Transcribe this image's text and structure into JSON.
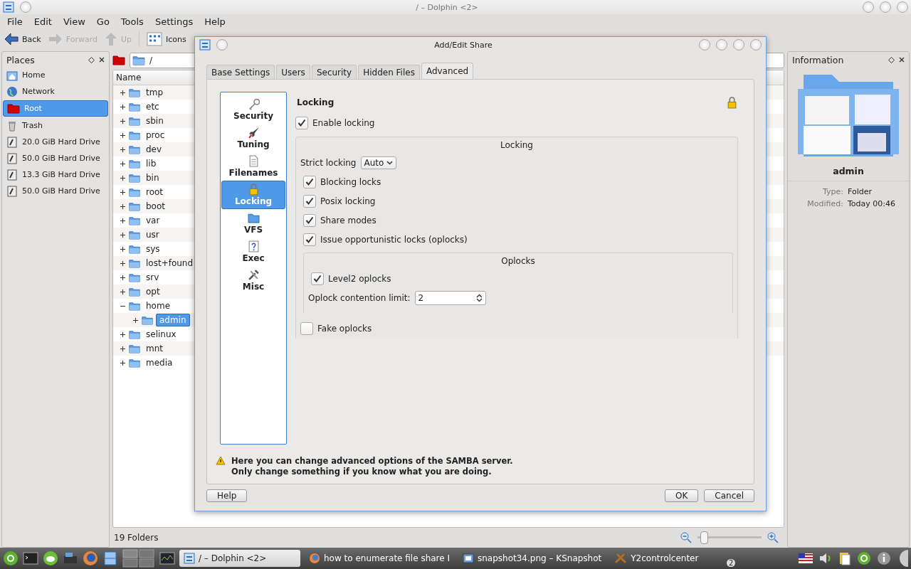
{
  "main_window": {
    "title": "/ – Dolphin <2>"
  },
  "menu": [
    "File",
    "Edit",
    "View",
    "Go",
    "Tools",
    "Settings",
    "Help"
  ],
  "toolbar": [
    {
      "label": "Back",
      "kind": "back",
      "disabled": false
    },
    {
      "label": "Forward",
      "kind": "forward",
      "disabled": true
    },
    {
      "label": "Up",
      "kind": "up",
      "disabled": true
    },
    {
      "label": "Icons",
      "kind": "view",
      "disabled": false
    }
  ],
  "places": {
    "title": "Places",
    "items": [
      {
        "label": "Home",
        "kind": "home",
        "selected": false
      },
      {
        "label": "Network",
        "kind": "network",
        "selected": false
      },
      {
        "label": "Root",
        "kind": "root",
        "selected": true
      },
      {
        "label": "Trash",
        "kind": "trash",
        "selected": false
      },
      {
        "label": "20.0 GiB Hard Drive",
        "kind": "drive",
        "selected": false
      },
      {
        "label": "50.0 GiB Hard Drive",
        "kind": "drive",
        "selected": false
      },
      {
        "label": "13.3 GiB Hard Drive",
        "kind": "drive",
        "selected": false
      },
      {
        "label": "50.0 GiB Hard Drive",
        "kind": "drive",
        "selected": false
      }
    ]
  },
  "location": "/",
  "files": {
    "column": "Name",
    "items": [
      {
        "name": "tmp",
        "expanded": false,
        "selected": false
      },
      {
        "name": "etc",
        "expanded": false,
        "selected": false
      },
      {
        "name": "sbin",
        "expanded": false,
        "selected": false
      },
      {
        "name": "proc",
        "expanded": false,
        "selected": false
      },
      {
        "name": "dev",
        "expanded": false,
        "selected": false
      },
      {
        "name": "lib",
        "expanded": false,
        "selected": false
      },
      {
        "name": "bin",
        "expanded": false,
        "selected": false
      },
      {
        "name": "root",
        "expanded": false,
        "selected": false
      },
      {
        "name": "boot",
        "expanded": false,
        "selected": false
      },
      {
        "name": "var",
        "expanded": false,
        "selected": false
      },
      {
        "name": "usr",
        "expanded": false,
        "selected": false
      },
      {
        "name": "sys",
        "expanded": false,
        "selected": false
      },
      {
        "name": "lost+found",
        "expanded": false,
        "selected": false
      },
      {
        "name": "srv",
        "expanded": false,
        "selected": false
      },
      {
        "name": "opt",
        "expanded": false,
        "selected": false
      },
      {
        "name": "home",
        "expanded": true,
        "selected": false,
        "children": [
          {
            "name": "admin",
            "expanded": false,
            "selected": true
          }
        ]
      },
      {
        "name": "selinux",
        "expanded": false,
        "selected": false
      },
      {
        "name": "mnt",
        "expanded": false,
        "selected": false
      },
      {
        "name": "media",
        "expanded": false,
        "selected": false
      }
    ]
  },
  "status": "19 Folders",
  "zoom_slider": {
    "level": 0.05
  },
  "information": {
    "title": "Information",
    "name": "admin",
    "fields": [
      {
        "label": "Type:",
        "value": "Folder"
      },
      {
        "label": "Modified:",
        "value": "Today 00:46"
      }
    ]
  },
  "dialog": {
    "title": "Add/Edit Share",
    "tabs": [
      {
        "label": "Base Settings",
        "selected": false
      },
      {
        "label": "Users",
        "selected": false
      },
      {
        "label": "Security",
        "selected": false
      },
      {
        "label": "Hidden Files",
        "selected": false
      },
      {
        "label": "Advanced",
        "selected": true
      }
    ],
    "sections": [
      {
        "label": "Security",
        "kind": "key",
        "selected": false
      },
      {
        "label": "Tuning",
        "kind": "rocket",
        "selected": false
      },
      {
        "label": "Filenames",
        "kind": "page",
        "selected": false
      },
      {
        "label": "Locking",
        "kind": "lock",
        "selected": true
      },
      {
        "label": "VFS",
        "kind": "folder",
        "selected": false
      },
      {
        "label": "Exec",
        "kind": "help",
        "selected": false
      },
      {
        "label": "Misc",
        "kind": "tools",
        "selected": false
      }
    ],
    "heading": "Locking",
    "enable_locking": {
      "label": "Enable locking",
      "checked": true
    },
    "group": {
      "title": "Locking",
      "strict_locking": {
        "label": "Strict locking",
        "value": "Auto"
      },
      "options": [
        {
          "label": "Blocking locks",
          "checked": true
        },
        {
          "label": "Posix locking",
          "checked": true
        },
        {
          "label": "Share modes",
          "checked": true
        },
        {
          "label": "Issue opportunistic locks (oplocks)",
          "checked": true
        }
      ],
      "oplocks": {
        "title": "Oplocks",
        "level2": {
          "label": "Level2 oplocks",
          "checked": true
        },
        "limit": {
          "label": "Oplock contention limit:",
          "value": "2"
        }
      },
      "fake": {
        "label": "Fake oplocks",
        "checked": false
      }
    },
    "warning": "**Here you can change advanced options of the SAMBA server.**\n**Only change something if you know what you are doing.**",
    "buttons": {
      "help": "Help",
      "ok": "OK",
      "cancel": "Cancel"
    }
  },
  "taskbar": {
    "tasks": [
      {
        "label": "/ – Dolphin <2>",
        "kind": "dolphin",
        "selected": true
      },
      {
        "label": "how to enumerate file share I",
        "kind": "firefox",
        "selected": false
      },
      {
        "label": "snapshot34.png – KSnapshot",
        "kind": "snapshot",
        "selected": false
      },
      {
        "label": "Y2controlcenter",
        "kind": "yast",
        "selected": false,
        "count": "2"
      }
    ]
  }
}
